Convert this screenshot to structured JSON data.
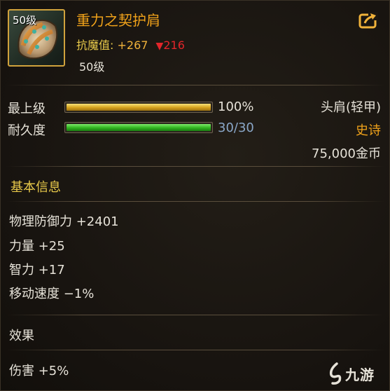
{
  "item": {
    "icon_level": "50级",
    "name": "重力之契护肩",
    "stat_label": "抗魔值:",
    "stat_value": "+267",
    "stat_down_arrow": "▼",
    "stat_down_value": "216",
    "required_level": "50级",
    "share_icon": "share-arrow-icon",
    "name_color": "#f0a21a"
  },
  "bars": {
    "grade": {
      "label": "最上级",
      "value_text": "100%",
      "fill_fraction": 1.0,
      "color": "#d7a21c"
    },
    "durability": {
      "label": "耐久度",
      "value_text": "30/30",
      "fill_fraction": 1.0,
      "color": "#2fb31f"
    }
  },
  "info_right": {
    "slot": "头肩(轻甲)",
    "rarity": "史诗",
    "rarity_color": "#f0a21a",
    "price": "75,000金币"
  },
  "basic_info": {
    "title": "基本信息",
    "attributes": [
      "物理防御力 +2401",
      "力量 +25",
      "智力 +17",
      "移动速度 −1%"
    ]
  },
  "effects": {
    "title": "效果",
    "items": [
      "伤害 +5%"
    ]
  },
  "watermark": {
    "logo_icon": "jiuyou-logo-icon",
    "text": "九游"
  }
}
